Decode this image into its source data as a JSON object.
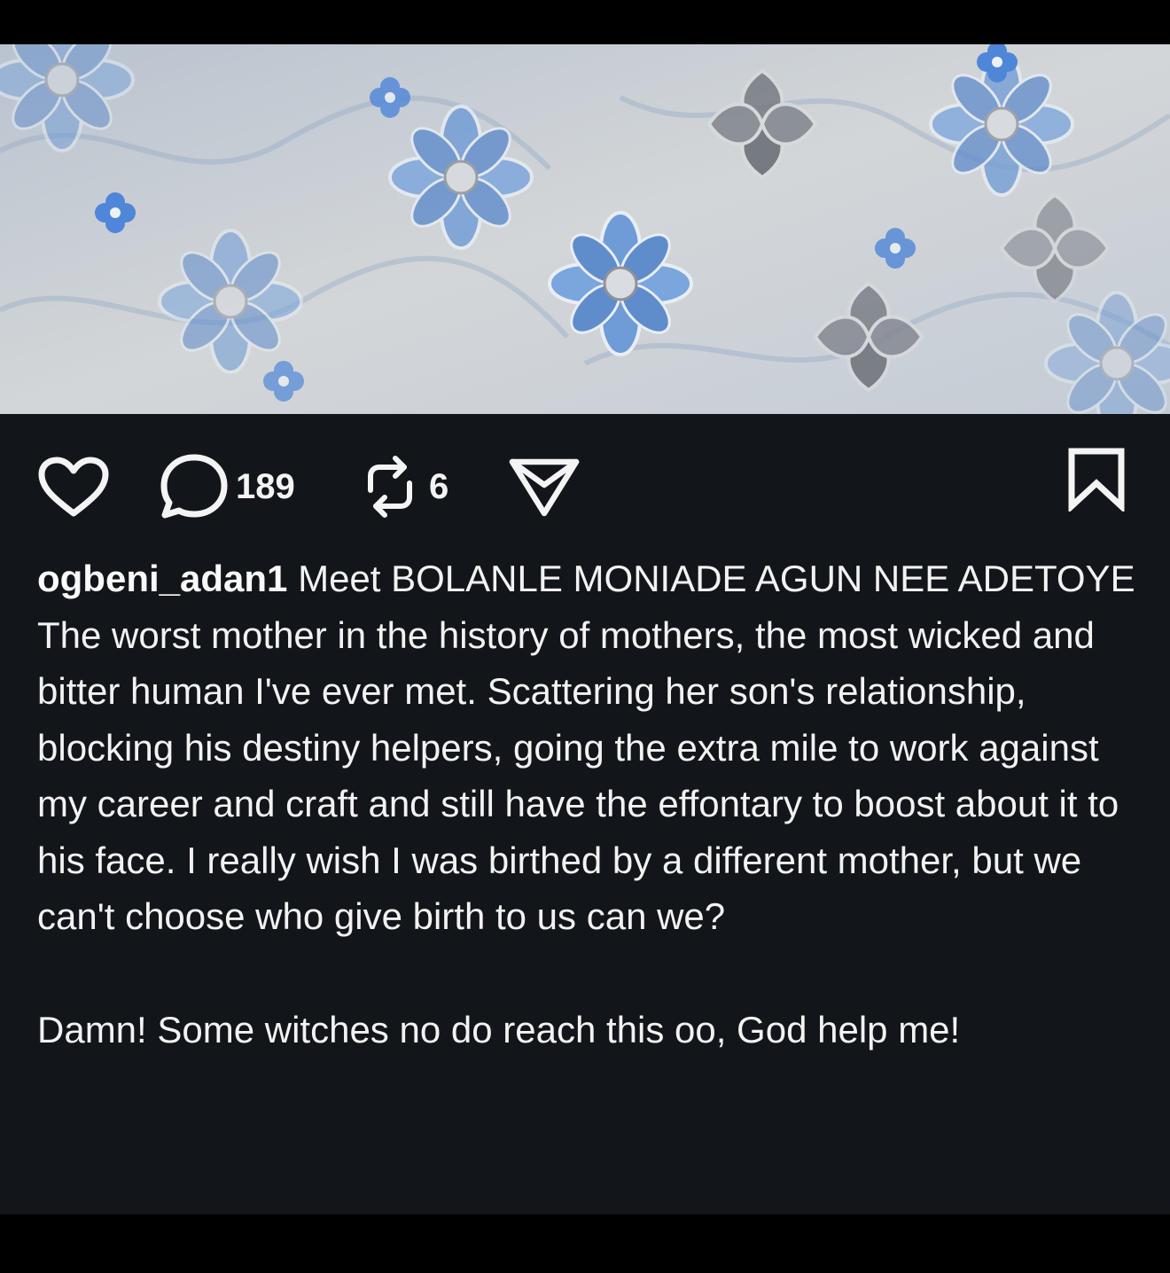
{
  "post": {
    "username": "ogbeni_adan1",
    "title_line": "Meet BOLANLE MONIADE AGUN NEE ADETOYE",
    "body": "The worst mother in the history of mothers, the most wicked and bitter human I've ever met. Scattering her son's relationship, blocking his destiny helpers, going the extra mile to work against my career and craft and still have the effontary to boost about it to his face. I really wish I was birthed by a different mother, but we can't choose who give birth to us can we?",
    "closing": "Damn! Some witches no do reach this oo, God help me!"
  },
  "actions": {
    "like_icon": "heart-icon",
    "comment_icon": "speech-bubble-icon",
    "comment_count": "189",
    "repost_icon": "repost-arrows-icon",
    "repost_count": "6",
    "share_icon": "paper-plane-icon",
    "bookmark_icon": "bookmark-icon"
  },
  "colors": {
    "background": "#12151a",
    "text": "#f2f2f2",
    "photo_primary": "#6f9bd6",
    "photo_secondary": "#7c8088"
  }
}
